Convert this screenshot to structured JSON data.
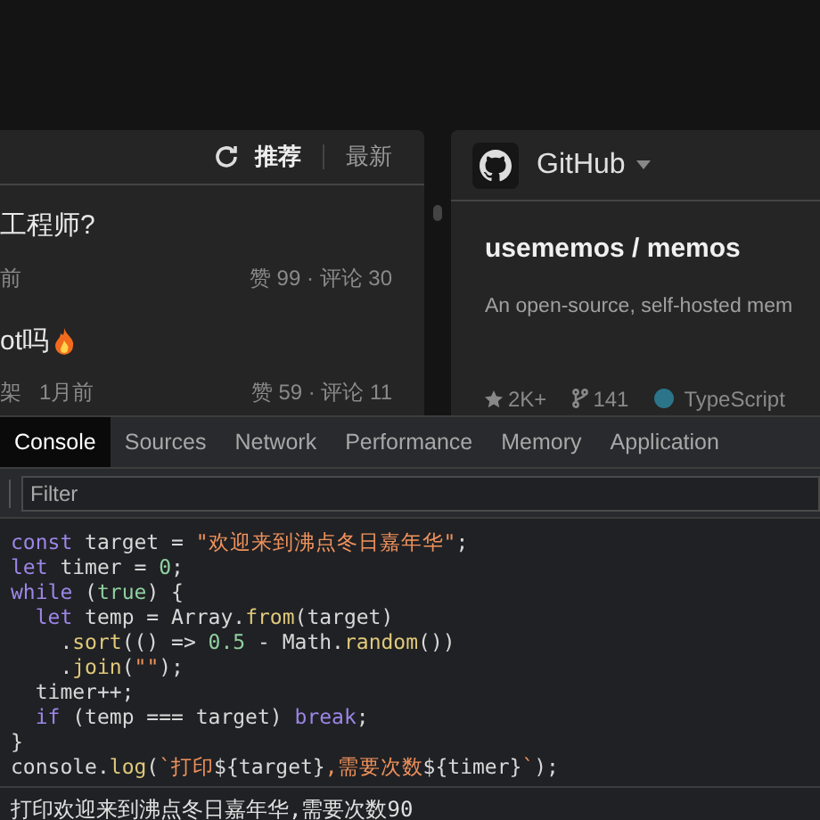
{
  "feed": {
    "tabs": [
      {
        "label": "推荐",
        "selected": true
      },
      {
        "label": "最新",
        "selected": false
      }
    ],
    "items": [
      {
        "title": "工程师?",
        "hot": false,
        "meta": [
          "前"
        ],
        "stats": "赞 99 · 评论 30"
      },
      {
        "title": "ot吗",
        "hot": true,
        "meta": [
          "架",
          "1月前"
        ],
        "stats": "赞 59 · 评论 11"
      }
    ]
  },
  "github": {
    "title": "GitHub",
    "repo": "usememos / memos",
    "description": "An open-source, self-hosted mem",
    "stars": "2K+",
    "forks": "141",
    "language": "TypeScript"
  },
  "devtools": {
    "tabs": [
      {
        "label": "Console",
        "selected": true
      },
      {
        "label": "Sources",
        "selected": false
      },
      {
        "label": "Network",
        "selected": false
      },
      {
        "label": "Performance",
        "selected": false
      },
      {
        "label": "Memory",
        "selected": false
      },
      {
        "label": "Application",
        "selected": false
      }
    ],
    "filter": {
      "placeholder": "Filter"
    },
    "code_lines": [
      [
        {
          "kind": "keyword",
          "text": "const"
        },
        {
          "kind": "plain",
          "text": " target = "
        },
        {
          "kind": "string",
          "text": "\"欢迎来到沸点冬日嘉年华\""
        },
        {
          "kind": "plain",
          "text": ";"
        }
      ],
      [
        {
          "kind": "keyword",
          "text": "let"
        },
        {
          "kind": "plain",
          "text": " timer = "
        },
        {
          "kind": "number",
          "text": "0"
        },
        {
          "kind": "plain",
          "text": ";"
        }
      ],
      [
        {
          "kind": "keyword",
          "text": "while"
        },
        {
          "kind": "plain",
          "text": " ("
        },
        {
          "kind": "number",
          "text": "true"
        },
        {
          "kind": "plain",
          "text": ") {"
        }
      ],
      [
        {
          "kind": "keyword",
          "text": "  let"
        },
        {
          "kind": "plain",
          "text": " temp = Array."
        },
        {
          "kind": "function",
          "text": "from"
        },
        {
          "kind": "plain",
          "text": "(target)"
        }
      ],
      [
        {
          "kind": "plain",
          "text": "    ."
        },
        {
          "kind": "function",
          "text": "sort"
        },
        {
          "kind": "plain",
          "text": "(() => "
        },
        {
          "kind": "number",
          "text": "0.5"
        },
        {
          "kind": "plain",
          "text": " - Math."
        },
        {
          "kind": "function",
          "text": "random"
        },
        {
          "kind": "plain",
          "text": "())"
        }
      ],
      [
        {
          "kind": "plain",
          "text": "    ."
        },
        {
          "kind": "function",
          "text": "join"
        },
        {
          "kind": "plain",
          "text": "("
        },
        {
          "kind": "string",
          "text": "\"\""
        },
        {
          "kind": "plain",
          "text": ");"
        }
      ],
      [
        {
          "kind": "plain",
          "text": "  timer++;"
        }
      ],
      [
        {
          "kind": "keyword",
          "text": "  if"
        },
        {
          "kind": "plain",
          "text": " (temp === target) "
        },
        {
          "kind": "keyword",
          "text": "break"
        },
        {
          "kind": "plain",
          "text": ";"
        }
      ],
      [
        {
          "kind": "plain",
          "text": "}"
        }
      ],
      [
        {
          "kind": "plain",
          "text": "console."
        },
        {
          "kind": "function",
          "text": "log"
        },
        {
          "kind": "plain",
          "text": "("
        },
        {
          "kind": "string",
          "text": "`打印"
        },
        {
          "kind": "plain",
          "text": "${target}"
        },
        {
          "kind": "string",
          "text": ",需要次数"
        },
        {
          "kind": "plain",
          "text": "${timer}"
        },
        {
          "kind": "string",
          "text": "`"
        },
        {
          "kind": "plain",
          "text": ");"
        }
      ]
    ],
    "output": "打印欢迎来到沸点冬日嘉年华,需要次数90"
  }
}
